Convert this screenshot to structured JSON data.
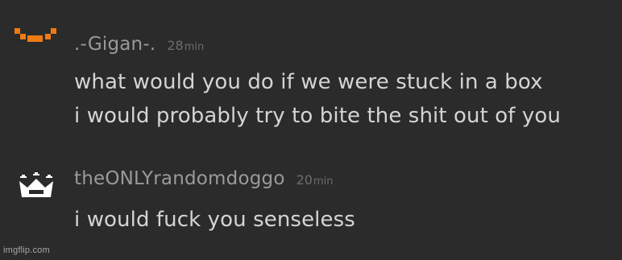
{
  "comments": [
    {
      "avatar_icon": "orange-pixel-face-icon",
      "username": ".-Gigan-.",
      "time_value": "28",
      "time_unit": "min",
      "lines": [
        "what would you do if we were stuck in a box",
        "i would probably try to bite the shit out of you"
      ]
    },
    {
      "avatar_icon": "white-crown-icon",
      "username": "theONLYrandomdoggo",
      "time_value": "20",
      "time_unit": "min",
      "lines": [
        "i would fuck you senseless"
      ]
    }
  ],
  "watermark": "imgflip.com",
  "colors": {
    "background": "#2b2b2b",
    "username": "#9a9a9a",
    "timestamp": "#6c6c6c",
    "text": "#d4d4d4",
    "avatar_orange": "#f07a12",
    "avatar_white": "#ffffff"
  }
}
